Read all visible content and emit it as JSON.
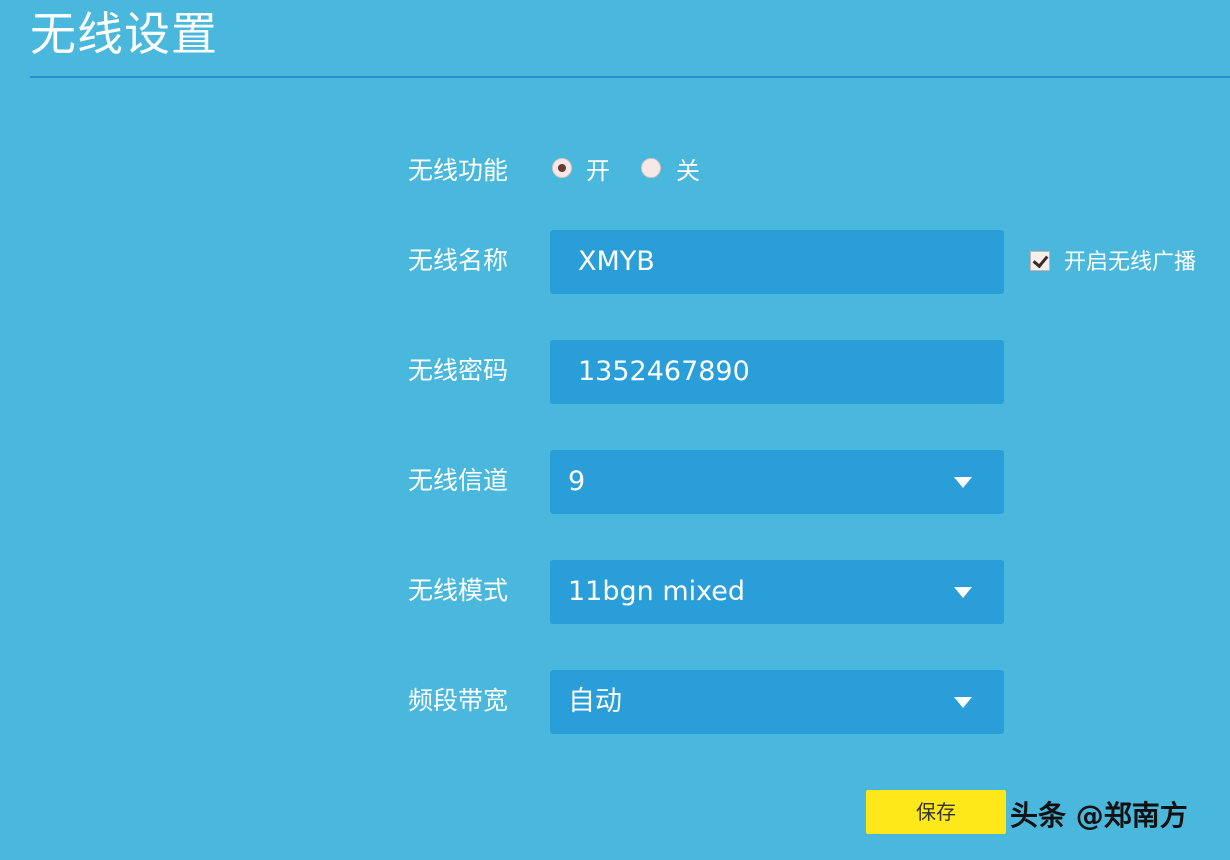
{
  "page": {
    "title": "无线设置"
  },
  "wireless_function": {
    "label": "无线功能",
    "options": [
      "开",
      "关"
    ],
    "selected": "开"
  },
  "ssid": {
    "label": "无线名称",
    "value": "XMYB",
    "broadcast": {
      "label": "开启无线广播",
      "checked": true
    }
  },
  "password": {
    "label": "无线密码",
    "value": "1352467890"
  },
  "channel": {
    "label": "无线信道",
    "value": "9"
  },
  "mode": {
    "label": "无线模式",
    "value": "11bgn mixed"
  },
  "bandwidth": {
    "label": "频段带宽",
    "value": "自动"
  },
  "actions": {
    "save_label": "保存"
  },
  "watermark": "头条 @郑南方",
  "colors": {
    "background": "#4ab8dc",
    "field": "#2a9ed8",
    "rule": "#2a8fcf",
    "save_button": "#ffe81a"
  }
}
